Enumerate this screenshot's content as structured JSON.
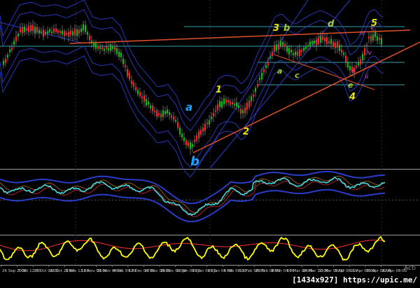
{
  "chart_data": [
    {
      "type": "candlestick",
      "panel": "price",
      "colors": {
        "bull": "#00c800",
        "bear": "#ff2020",
        "grid": "#2a2a2a",
        "envelope": "#2a3cc8",
        "trendline": "#e0502a",
        "level_line": "#3aa0a8",
        "wick": "#aaaaaa"
      },
      "wave_labels": [
        {
          "text": "a",
          "color": "#1aa3ff",
          "style": "bold-italic"
        },
        {
          "text": "b",
          "color": "#1aa3ff",
          "style": "bold-italic"
        },
        {
          "text": "1",
          "color": "#e6e600",
          "style": "bold-italic"
        },
        {
          "text": "2",
          "color": "#e6e600",
          "style": "bold-italic"
        },
        {
          "text": "3",
          "color": "#e6e600",
          "style": "bold-italic"
        },
        {
          "text": "b",
          "color": "#9acd32",
          "style": "bold-italic"
        },
        {
          "text": "d",
          "color": "#9acd32",
          "style": "bold-italic"
        },
        {
          "text": "5",
          "color": "#e6e600",
          "style": "bold-italic"
        },
        {
          "text": "a",
          "color": "#9acd32",
          "style": "bold-italic"
        },
        {
          "text": "c",
          "color": "#9acd32",
          "style": "bold-italic"
        },
        {
          "text": "e",
          "color": "#9acd32",
          "style": "bold-italic"
        },
        {
          "text": "4",
          "color": "#e6e600",
          "style": "bold-italic"
        },
        {
          "text": "i",
          "color": "#d84dd8",
          "style": "italic"
        },
        {
          "text": "ii",
          "color": "#d84dd8",
          "style": "italic"
        },
        {
          "text": "iii",
          "color": "#d84dd8",
          "style": "italic"
        },
        {
          "text": "iv",
          "color": "#d84dd8",
          "style": "italic"
        },
        {
          "text": "v",
          "color": "#d84dd8",
          "style": "italic"
        }
      ]
    },
    {
      "type": "line",
      "panel": "oscillator-1",
      "colors": {
        "main": "#40e0e8",
        "band": "#2a3cc8",
        "signal_a": "#c83030",
        "signal_b": "#b07020"
      }
    },
    {
      "type": "line",
      "panel": "oscillator-2",
      "colors": {
        "main": "#ffff00",
        "signal": "#ff3030"
      }
    }
  ],
  "x_axis": {
    "tick_labels": [
      "26 Sep 2008",
      "7 Oct 12:00",
      "15 Oct 04:00",
      "22 Oct 20:00",
      "3 Nov 12:00",
      "11 Nov 08:00",
      "21 Nov 04:00",
      "4 Dec 04:00",
      "12 Dec 04:00",
      "17 Dec 08:00",
      "29 Dec 04:00",
      "12 Jan 08:00",
      "19 Jan 08:00",
      "29 Jan 04:00",
      "3 Feb 08:00",
      "11 Feb 08:00",
      "26 Feb 08:00",
      "9 Mar 04:00",
      "17 Mar 08:00",
      "24 Mar 12:00",
      "31 Mar 08:00",
      "3 Apr 08:00",
      "11 Apr 08:00",
      "16 Apr 04:00",
      "22 Apr 08:00"
    ]
  },
  "overlay": {
    "act_text": "Acti",
    "watermark": "[1434x927] https://upic.me/"
  }
}
